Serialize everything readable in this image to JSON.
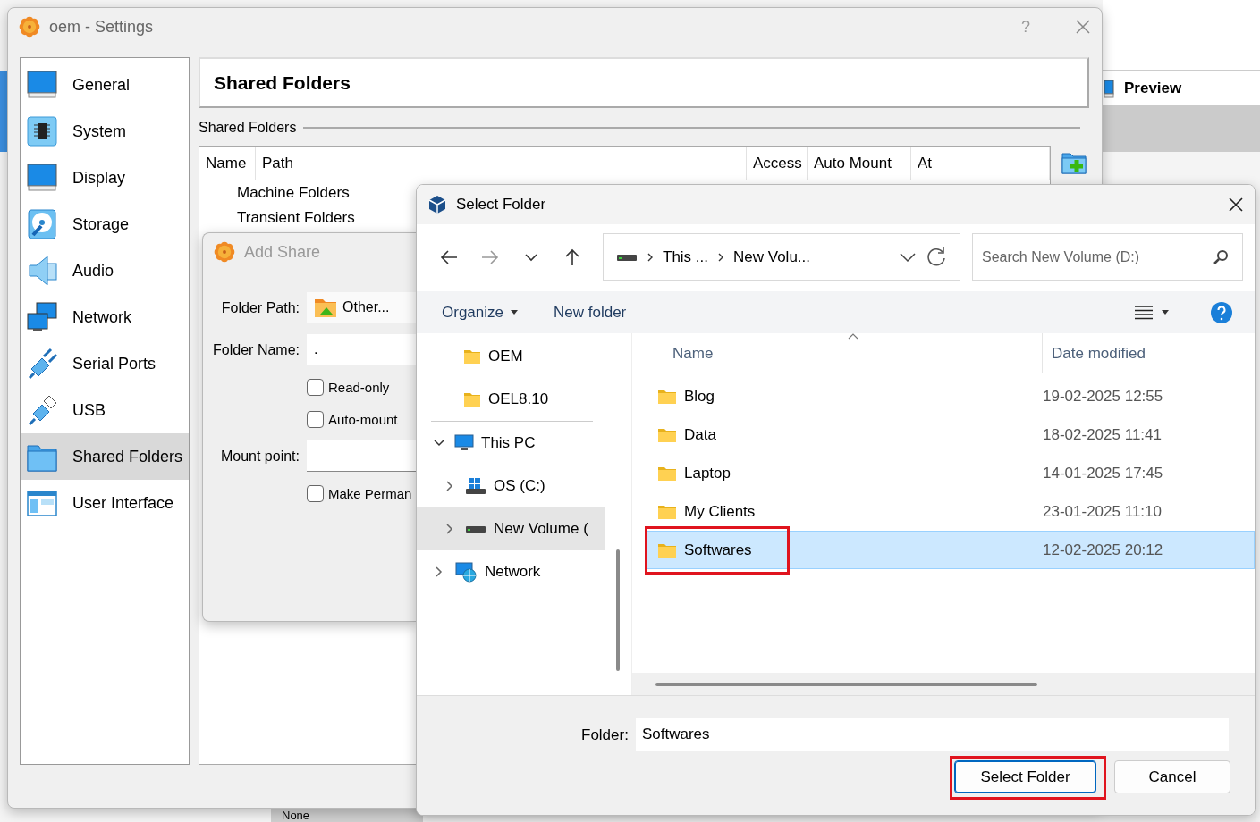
{
  "background": {
    "preview_title": "Preview",
    "none_label": "None"
  },
  "settings": {
    "title": "oem - Settings",
    "help": "?",
    "sidebar": [
      {
        "label": "General",
        "selected": false
      },
      {
        "label": "System",
        "selected": false
      },
      {
        "label": "Display",
        "selected": false
      },
      {
        "label": "Storage",
        "selected": false
      },
      {
        "label": "Audio",
        "selected": false
      },
      {
        "label": "Network",
        "selected": false
      },
      {
        "label": "Serial Ports",
        "selected": false
      },
      {
        "label": "USB",
        "selected": false
      },
      {
        "label": "Shared Folders",
        "selected": true
      },
      {
        "label": "User Interface",
        "selected": false
      }
    ],
    "page_title": "Shared Folders",
    "group_label": "Shared Folders",
    "table": {
      "columns": [
        "Name",
        "Path",
        "Access",
        "Auto Mount",
        "At"
      ],
      "rows": [
        {
          "name": "Machine Folders"
        },
        {
          "name": "Transient Folders"
        }
      ]
    }
  },
  "add_share": {
    "title": "Add Share",
    "fields": [
      {
        "kind": "combo",
        "label": "Folder Path:",
        "value": "Other..."
      },
      {
        "kind": "text",
        "label": "Folder Name:",
        "value": "."
      },
      {
        "kind": "checkbox",
        "label": "Read-only",
        "checked": false
      },
      {
        "kind": "checkbox",
        "label": "Auto-mount",
        "checked": false
      },
      {
        "kind": "text",
        "label": "Mount point:"
      },
      {
        "kind": "checkbox",
        "label": "Make Perman",
        "checked": false
      }
    ]
  },
  "select_folder": {
    "title": "Select Folder",
    "address": [
      "This ...",
      "New Volu..."
    ],
    "search": {
      "placeholder": "Search New Volume (D:)"
    },
    "toolbar": {
      "organize": "Organize",
      "new_folder": "New folder"
    },
    "quick_access": [
      {
        "label": "OEM"
      },
      {
        "label": "OEL8.10"
      }
    ],
    "tree": [
      {
        "label": "This PC",
        "kind": "pc",
        "expanded": true,
        "selected": false,
        "children": [
          {
            "label": "OS (C:)",
            "kind": "windows-drive",
            "expanded": false,
            "selected": false
          },
          {
            "label": "New Volume (",
            "kind": "drive",
            "expanded": false,
            "selected": true
          }
        ]
      },
      {
        "label": "Network",
        "kind": "network",
        "expanded": false,
        "selected": false
      }
    ],
    "files": {
      "columns": [
        "Name",
        "Date modified"
      ],
      "rows": [
        {
          "name": "Blog",
          "date": "19-02-2025 12:55",
          "selected": false,
          "highlighted": false
        },
        {
          "name": "Data",
          "date": "18-02-2025 11:41",
          "selected": false,
          "highlighted": false
        },
        {
          "name": "Laptop",
          "date": "14-01-2025 17:45",
          "selected": false,
          "highlighted": false
        },
        {
          "name": "My Clients",
          "date": "23-01-2025 11:10",
          "selected": false,
          "highlighted": false
        },
        {
          "name": "Softwares",
          "date": "12-02-2025 20:12",
          "selected": true,
          "highlighted": true
        }
      ]
    },
    "folder_label": "Folder:",
    "folder_value": "Softwares",
    "buttons": [
      {
        "label": "Select Folder",
        "kind": "primary",
        "highlighted": true
      },
      {
        "label": "Cancel",
        "kind": "secondary",
        "highlighted": false
      }
    ]
  }
}
